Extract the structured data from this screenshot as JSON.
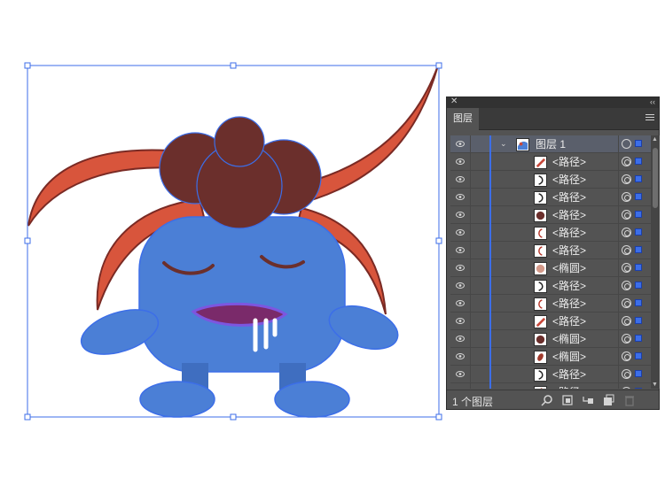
{
  "layers_panel": {
    "tab_label": "图层",
    "close_glyph": "✕",
    "collapse_glyph": "‹‹",
    "layer_count": "1 个图层",
    "top_layer": {
      "name": "图层 1",
      "expanded": true
    },
    "items": [
      {
        "name": "<路径>",
        "thumb": "red-stripe"
      },
      {
        "name": "<路径>",
        "thumb": "arc-dark"
      },
      {
        "name": "<路径>",
        "thumb": "arc-dark"
      },
      {
        "name": "<路径>",
        "thumb": "brown-circle"
      },
      {
        "name": "<路径>",
        "thumb": "arc-red"
      },
      {
        "name": "<路径>",
        "thumb": "arc-red"
      },
      {
        "name": "<椭圆>",
        "thumb": "pink-circle"
      },
      {
        "name": "<路径>",
        "thumb": "arc-dark"
      },
      {
        "name": "<路径>",
        "thumb": "arc-red"
      },
      {
        "name": "<路径>",
        "thumb": "red-stripe"
      },
      {
        "name": "<椭圆>",
        "thumb": "brown-circle"
      },
      {
        "name": "<椭圆>",
        "thumb": "red-oval"
      },
      {
        "name": "<路径>",
        "thumb": "arc-dark"
      },
      {
        "name": "<路径>",
        "thumb": "arc-red"
      }
    ],
    "footer_icons": [
      "search-icon",
      "clipping-mask-icon",
      "new-sublayer-icon",
      "new-layer-icon",
      "trash-icon"
    ]
  },
  "colors": {
    "selection_blue": "#3c6ee8",
    "hair_red": "#d8553c",
    "hair_dark": "#7a2a24",
    "head_brown": "#6b2f2c",
    "body_blue": "#4b7fd6",
    "panel_bg": "#535353"
  }
}
